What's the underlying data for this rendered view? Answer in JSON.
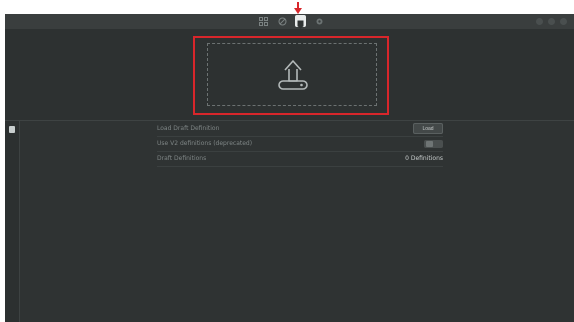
{
  "toolbar": {
    "icons": [
      "grid-icon",
      "brush-icon",
      "draft-icon",
      "gear-icon"
    ],
    "active": "draft-icon"
  },
  "drop_zone": {
    "icon": "upload-icon",
    "highlight_color": "#d8262b"
  },
  "settings": {
    "rows": [
      {
        "label": "Load Draft Definition",
        "control": "button",
        "button_label": "Load"
      },
      {
        "label": "Use V2 definitions (deprecated)",
        "control": "toggle",
        "checked": false
      },
      {
        "label": "Draft Definitions",
        "control": "value",
        "value": "0 Definitions"
      }
    ]
  },
  "colors": {
    "background": "#2f3333",
    "accent": "#d8262b",
    "label": "#7f8686"
  }
}
